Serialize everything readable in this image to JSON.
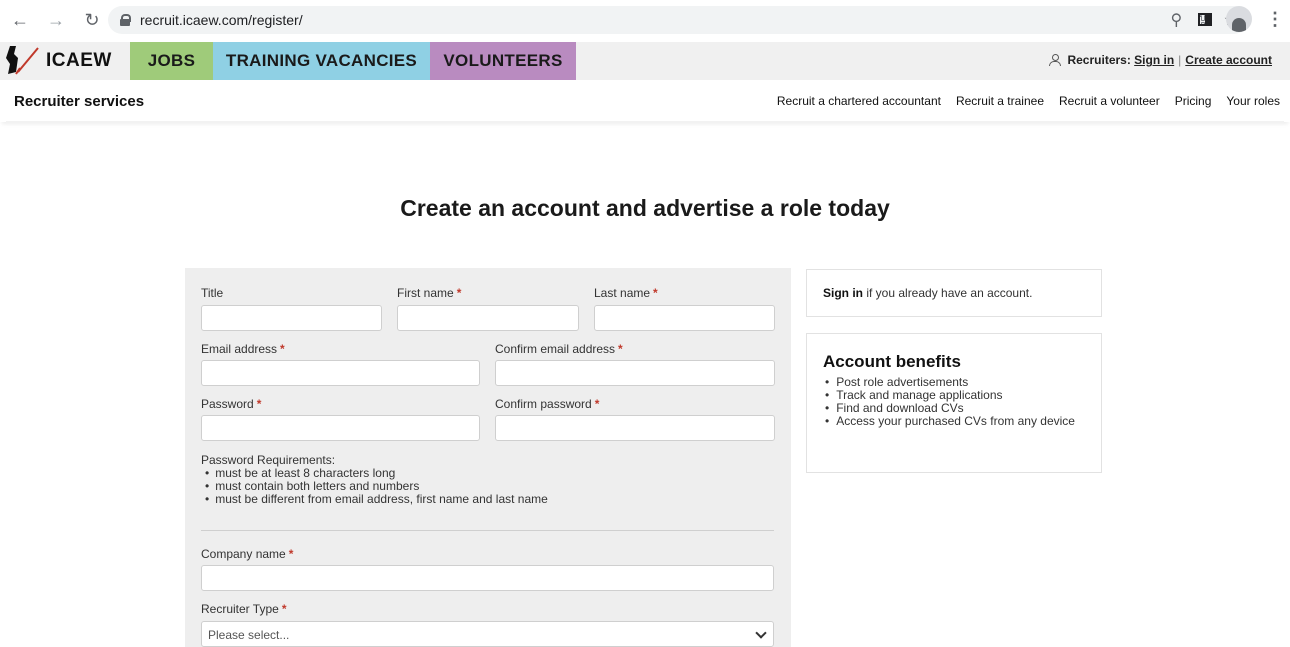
{
  "browser": {
    "url": "recruit.icaew.com/register/"
  },
  "site": {
    "logo_text": "ICAEW",
    "tabs": [
      {
        "label": "JOBS",
        "color": "#9fcb7a"
      },
      {
        "label": "TRAINING VACANCIES",
        "color": "#8fd0e4"
      },
      {
        "label": "VOLUNTEERS",
        "color": "#b98bc0"
      }
    ],
    "recruiters_label": "Recruiters:",
    "sign_in_link": "Sign in",
    "separator": "|",
    "create_account_link": "Create account"
  },
  "subnav": {
    "title": "Recruiter services",
    "links": [
      "Recruit a chartered accountant",
      "Recruit a trainee",
      "Recruit a volunteer",
      "Pricing",
      "Your roles"
    ]
  },
  "page": {
    "heading": "Create an account and advertise a role today"
  },
  "form": {
    "required_marker": "*",
    "title_label": "Title",
    "first_name_label": "First name",
    "last_name_label": "Last name",
    "email_label": "Email address",
    "confirm_email_label": "Confirm email address",
    "password_label": "Password",
    "confirm_password_label": "Confirm password",
    "password_requirements_title": "Password Requirements:",
    "password_requirements": [
      "must be at least 8 characters long",
      "must contain both letters and numbers",
      "must be different from email address, first name and last name"
    ],
    "company_name_label": "Company name",
    "recruiter_type_label": "Recruiter Type",
    "recruiter_type_value": "Please select..."
  },
  "sidebar": {
    "signin_link": "Sign in",
    "signin_text": " if you already have an account.",
    "benefits_title": "Account benefits",
    "benefits": [
      "Post role advertisements",
      "Track and manage applications",
      "Find and download CVs",
      "Access your purchased CVs from any device"
    ]
  }
}
